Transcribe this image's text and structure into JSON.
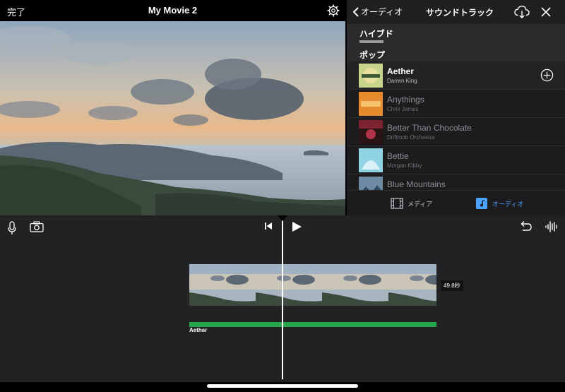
{
  "top_bar": {
    "done_label": "完了",
    "movie_title": "My Movie 2",
    "settings_icon": "gear-icon"
  },
  "panel": {
    "back_label": "オーディオ",
    "title": "サウンドトラック",
    "download_icon": "cloud-download-icon",
    "close_icon": "close-icon",
    "sections": {
      "hybrid": "ハイブド",
      "pop": "ポップ"
    },
    "tracks": [
      {
        "name": "Aether",
        "artist": "Darren King",
        "state": "active"
      },
      {
        "name": "Anythings",
        "artist": "Chris James",
        "state": "dim"
      },
      {
        "name": "Better Than Chocolate",
        "artist": "Driftmob Orchestra",
        "state": "dim"
      },
      {
        "name": "Bettie",
        "artist": "Morgan Kibby",
        "state": "dim"
      },
      {
        "name": "Blue Mountains",
        "artist": "",
        "state": "dim"
      }
    ],
    "tabs": {
      "media": "メディア",
      "audio": "オーディオ"
    },
    "colors": {
      "accent": "#4aa3ff",
      "panel_bg": "#1c1c1e"
    }
  },
  "timeline": {
    "duration": "49.8秒",
    "audio_label": "Aether",
    "audio_color": "#27a64f"
  }
}
